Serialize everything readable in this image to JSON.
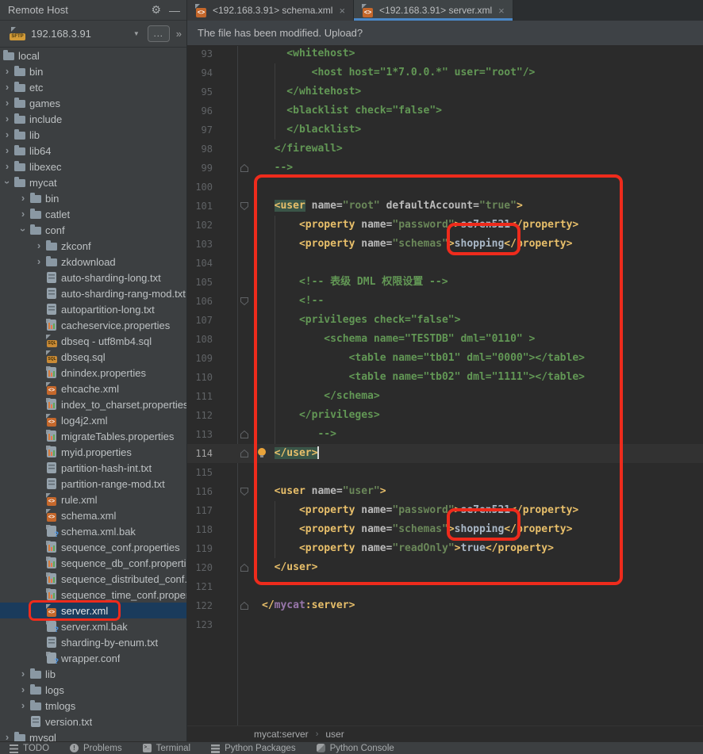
{
  "panel": {
    "title": "Remote Host",
    "host": "192.168.3.91",
    "browse_label": "...",
    "icons": {
      "gear": "⚙",
      "minimize": "—",
      "dropdown": "▼",
      "chevrons": "»",
      "sftp_badge": "SFTP",
      "close": "×",
      "tree_chevron": "›",
      "breadcrumb_sep": "›"
    }
  },
  "tabs": [
    {
      "label": "<192.168.3.91> schema.xml",
      "active": false
    },
    {
      "label": "<192.168.3.91> server.xml",
      "active": true
    }
  ],
  "notification": {
    "text": "The file has been modified. Upload?"
  },
  "colors": {
    "annotation_red": "#EE2B1C",
    "tab_underline": "#4A88C7",
    "tree_selection_bg": "#1A3B5C"
  },
  "tree": {
    "items": [
      {
        "label": "local",
        "icon": "folder",
        "level": 0,
        "chevron": "none"
      },
      {
        "label": "bin",
        "icon": "folder",
        "level": 1,
        "chevron": "collapsed"
      },
      {
        "label": "etc",
        "icon": "folder",
        "level": 1,
        "chevron": "collapsed"
      },
      {
        "label": "games",
        "icon": "folder",
        "level": 1,
        "chevron": "collapsed"
      },
      {
        "label": "include",
        "icon": "folder",
        "level": 1,
        "chevron": "collapsed"
      },
      {
        "label": "lib",
        "icon": "folder",
        "level": 1,
        "chevron": "collapsed"
      },
      {
        "label": "lib64",
        "icon": "folder",
        "level": 1,
        "chevron": "collapsed"
      },
      {
        "label": "libexec",
        "icon": "folder",
        "level": 1,
        "chevron": "collapsed"
      },
      {
        "label": "mycat",
        "icon": "folder",
        "level": 1,
        "chevron": "expanded"
      },
      {
        "label": "bin",
        "icon": "folder",
        "level": 2,
        "chevron": "collapsed"
      },
      {
        "label": "catlet",
        "icon": "folder",
        "level": 2,
        "chevron": "collapsed"
      },
      {
        "label": "conf",
        "icon": "folder",
        "level": 2,
        "chevron": "expanded"
      },
      {
        "label": "zkconf",
        "icon": "folder",
        "level": 3,
        "chevron": "collapsed"
      },
      {
        "label": "zkdownload",
        "icon": "folder",
        "level": 3,
        "chevron": "collapsed"
      },
      {
        "label": "auto-sharding-long.txt",
        "icon": "txt",
        "level": 3,
        "chevron": "none"
      },
      {
        "label": "auto-sharding-rang-mod.txt",
        "icon": "txt",
        "level": 3,
        "chevron": "none"
      },
      {
        "label": "autopartition-long.txt",
        "icon": "txt",
        "level": 3,
        "chevron": "none"
      },
      {
        "label": "cacheservice.properties",
        "icon": "props",
        "level": 3,
        "chevron": "none"
      },
      {
        "label": "dbseq - utf8mb4.sql",
        "icon": "sql",
        "level": 3,
        "chevron": "none"
      },
      {
        "label": "dbseq.sql",
        "icon": "sql",
        "level": 3,
        "chevron": "none"
      },
      {
        "label": "dnindex.properties",
        "icon": "props",
        "level": 3,
        "chevron": "none"
      },
      {
        "label": "ehcache.xml",
        "icon": "xml",
        "level": 3,
        "chevron": "none"
      },
      {
        "label": "index_to_charset.properties",
        "icon": "props",
        "level": 3,
        "chevron": "none"
      },
      {
        "label": "log4j2.xml",
        "icon": "xml",
        "level": 3,
        "chevron": "none"
      },
      {
        "label": "migrateTables.properties",
        "icon": "props",
        "level": 3,
        "chevron": "none"
      },
      {
        "label": "myid.properties",
        "icon": "props",
        "level": 3,
        "chevron": "none"
      },
      {
        "label": "partition-hash-int.txt",
        "icon": "txt",
        "level": 3,
        "chevron": "none"
      },
      {
        "label": "partition-range-mod.txt",
        "icon": "txt",
        "level": 3,
        "chevron": "none"
      },
      {
        "label": "rule.xml",
        "icon": "xml",
        "level": 3,
        "chevron": "none"
      },
      {
        "label": "schema.xml",
        "icon": "xml",
        "level": 3,
        "chevron": "none"
      },
      {
        "label": "schema.xml.bak",
        "icon": "unknown",
        "level": 3,
        "chevron": "none"
      },
      {
        "label": "sequence_conf.properties",
        "icon": "props",
        "level": 3,
        "chevron": "none"
      },
      {
        "label": "sequence_db_conf.properties",
        "icon": "props",
        "level": 3,
        "chevron": "none"
      },
      {
        "label": "sequence_distributed_conf.properties",
        "icon": "props",
        "level": 3,
        "chevron": "none"
      },
      {
        "label": "sequence_time_conf.properties",
        "icon": "props",
        "level": 3,
        "chevron": "none"
      },
      {
        "label": "server.xml",
        "icon": "xml",
        "level": 3,
        "chevron": "none",
        "selected": true,
        "annotated": true
      },
      {
        "label": "server.xml.bak",
        "icon": "unknown",
        "level": 3,
        "chevron": "none"
      },
      {
        "label": "sharding-by-enum.txt",
        "icon": "txt",
        "level": 3,
        "chevron": "none"
      },
      {
        "label": "wrapper.conf",
        "icon": "unknown",
        "level": 3,
        "chevron": "none"
      },
      {
        "label": "lib",
        "icon": "folder",
        "level": 2,
        "chevron": "collapsed"
      },
      {
        "label": "logs",
        "icon": "folder",
        "level": 2,
        "chevron": "collapsed"
      },
      {
        "label": "tmlogs",
        "icon": "folder",
        "level": 2,
        "chevron": "collapsed"
      },
      {
        "label": "version.txt",
        "icon": "txt",
        "level": 2,
        "chevron": "none"
      },
      {
        "label": "mysql",
        "icon": "folder",
        "level": 1,
        "chevron": "collapsed"
      }
    ]
  },
  "editor": {
    "lines": [
      {
        "num": 93,
        "tokens": [
          {
            "t": "com",
            "s": "    <whitehost>"
          }
        ]
      },
      {
        "num": 94,
        "tokens": [
          {
            "t": "com",
            "s": "        <host host=\"1*7.0.0.*\" user=\"root\"/>"
          }
        ]
      },
      {
        "num": 95,
        "tokens": [
          {
            "t": "com",
            "s": "    </whitehost>"
          }
        ]
      },
      {
        "num": 96,
        "tokens": [
          {
            "t": "com",
            "s": "    <blacklist check=\"false\">"
          }
        ]
      },
      {
        "num": 97,
        "tokens": [
          {
            "t": "com",
            "s": "    </blacklist>"
          }
        ]
      },
      {
        "num": 98,
        "tokens": [
          {
            "t": "com",
            "s": "  </firewall>"
          }
        ]
      },
      {
        "num": 99,
        "fold": "up",
        "tokens": [
          {
            "t": "com",
            "s": "  -->"
          }
        ]
      },
      {
        "num": 100,
        "tokens": []
      },
      {
        "num": 101,
        "fold": "down",
        "tokens": [
          {
            "t": "pln",
            "s": "  "
          },
          {
            "t": "hltag",
            "s": "<user"
          },
          {
            "t": "pln",
            "s": " "
          },
          {
            "t": "attr",
            "s": "name="
          },
          {
            "t": "val",
            "s": "\"root\""
          },
          {
            "t": "pln",
            "s": " "
          },
          {
            "t": "attr",
            "s": "defaultAccount="
          },
          {
            "t": "val",
            "s": "\"true\""
          },
          {
            "t": "tag",
            "s": ">"
          }
        ]
      },
      {
        "num": 102,
        "tokens": [
          {
            "t": "pln",
            "s": "      "
          },
          {
            "t": "tag",
            "s": "<property"
          },
          {
            "t": "pln",
            "s": " "
          },
          {
            "t": "attr",
            "s": "name="
          },
          {
            "t": "val",
            "s": "\"password\""
          },
          {
            "t": "tag",
            "s": ">"
          },
          {
            "t": "txt",
            "s": "se7en521"
          },
          {
            "t": "tag",
            "s": "</property>"
          }
        ]
      },
      {
        "num": 103,
        "tokens": [
          {
            "t": "pln",
            "s": "      "
          },
          {
            "t": "tag",
            "s": "<property"
          },
          {
            "t": "pln",
            "s": " "
          },
          {
            "t": "attr",
            "s": "name="
          },
          {
            "t": "val",
            "s": "\"schemas\""
          },
          {
            "t": "tag",
            "s": ">"
          },
          {
            "t": "txt",
            "s": "shopping"
          },
          {
            "t": "tag",
            "s": "</property>"
          }
        ]
      },
      {
        "num": 104,
        "tokens": []
      },
      {
        "num": 105,
        "tokens": [
          {
            "t": "com",
            "s": "      <!-- 表级 DML 权限设置 -->"
          }
        ]
      },
      {
        "num": 106,
        "fold": "down",
        "tokens": [
          {
            "t": "com",
            "s": "      <!--"
          }
        ]
      },
      {
        "num": 107,
        "tokens": [
          {
            "t": "com",
            "s": "      <privileges check=\"false\">"
          }
        ]
      },
      {
        "num": 108,
        "tokens": [
          {
            "t": "com",
            "s": "          <schema name=\"TESTDB\" dml=\"0110\" >"
          }
        ]
      },
      {
        "num": 109,
        "tokens": [
          {
            "t": "com",
            "s": "              <table name=\"tb01\" dml=\"0000\"></table>"
          }
        ]
      },
      {
        "num": 110,
        "tokens": [
          {
            "t": "com",
            "s": "              <table name=\"tb02\" dml=\"1111\"></table>"
          }
        ]
      },
      {
        "num": 111,
        "tokens": [
          {
            "t": "com",
            "s": "          </schema>"
          }
        ]
      },
      {
        "num": 112,
        "tokens": [
          {
            "t": "com",
            "s": "      </privileges>"
          }
        ]
      },
      {
        "num": 113,
        "fold": "up",
        "tokens": [
          {
            "t": "com",
            "s": "         -->"
          }
        ]
      },
      {
        "num": 114,
        "fold": "up",
        "bulb": true,
        "current": true,
        "cursor": true,
        "tokens": [
          {
            "t": "pln",
            "s": "  "
          },
          {
            "t": "hltag",
            "s": "</user>"
          }
        ]
      },
      {
        "num": 115,
        "tokens": []
      },
      {
        "num": 116,
        "fold": "down",
        "tokens": [
          {
            "t": "pln",
            "s": "  "
          },
          {
            "t": "tag",
            "s": "<user"
          },
          {
            "t": "pln",
            "s": " "
          },
          {
            "t": "attr",
            "s": "name="
          },
          {
            "t": "val",
            "s": "\"user\""
          },
          {
            "t": "tag",
            "s": ">"
          }
        ]
      },
      {
        "num": 117,
        "tokens": [
          {
            "t": "pln",
            "s": "      "
          },
          {
            "t": "tag",
            "s": "<property"
          },
          {
            "t": "pln",
            "s": " "
          },
          {
            "t": "attr",
            "s": "name="
          },
          {
            "t": "val",
            "s": "\"password\""
          },
          {
            "t": "tag",
            "s": ">"
          },
          {
            "t": "txt",
            "s": "se7en521"
          },
          {
            "t": "tag",
            "s": "</property>"
          }
        ]
      },
      {
        "num": 118,
        "tokens": [
          {
            "t": "pln",
            "s": "      "
          },
          {
            "t": "tag",
            "s": "<property"
          },
          {
            "t": "pln",
            "s": " "
          },
          {
            "t": "attr",
            "s": "name="
          },
          {
            "t": "val",
            "s": "\"schemas\""
          },
          {
            "t": "tag",
            "s": ">"
          },
          {
            "t": "txt",
            "s": "shopping"
          },
          {
            "t": "tag",
            "s": "</property>"
          }
        ]
      },
      {
        "num": 119,
        "tokens": [
          {
            "t": "pln",
            "s": "      "
          },
          {
            "t": "tag",
            "s": "<property"
          },
          {
            "t": "pln",
            "s": " "
          },
          {
            "t": "attr",
            "s": "name="
          },
          {
            "t": "val",
            "s": "\"readOnly\""
          },
          {
            "t": "tag",
            "s": ">"
          },
          {
            "t": "txt",
            "s": "true"
          },
          {
            "t": "tag",
            "s": "</property>"
          }
        ]
      },
      {
        "num": 120,
        "fold": "up",
        "tokens": [
          {
            "t": "pln",
            "s": "  "
          },
          {
            "t": "tag",
            "s": "</user>"
          }
        ]
      },
      {
        "num": 121,
        "tokens": []
      },
      {
        "num": 122,
        "fold": "up",
        "tokens": [
          {
            "t": "tag",
            "s": "</"
          },
          {
            "t": "ns",
            "s": "mycat"
          },
          {
            "t": "tag",
            "s": ":server>"
          }
        ]
      },
      {
        "num": 123,
        "tokens": []
      }
    ]
  },
  "breadcrumbs": {
    "items": [
      "mycat:server",
      "user"
    ]
  },
  "statusbar": {
    "items": [
      {
        "icon": "todo-icon",
        "label": "TODO"
      },
      {
        "icon": "problems-icon",
        "label": "Problems"
      },
      {
        "icon": "terminal-icon",
        "label": "Terminal"
      },
      {
        "icon": "python-packages-icon",
        "label": "Python Packages"
      },
      {
        "icon": "python-console-icon",
        "label": "Python Console"
      }
    ]
  }
}
